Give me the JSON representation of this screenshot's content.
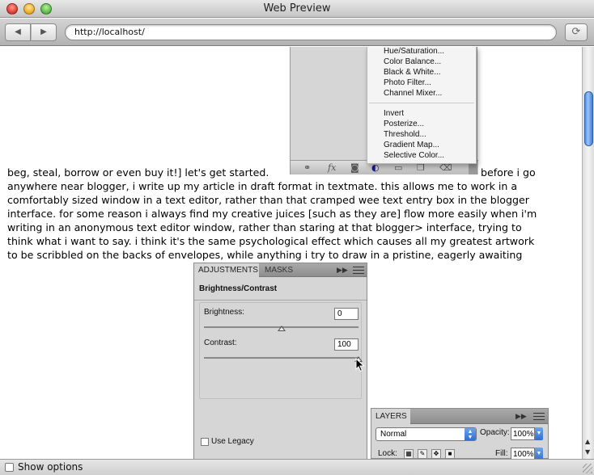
{
  "window": {
    "title": "Web Preview"
  },
  "toolbar": {
    "back_icon": "◀",
    "forward_icon": "▶",
    "url": "http://localhost/",
    "reload_icon": "⟳"
  },
  "adjustments_menu": {
    "items": [
      "Hue/Saturation...",
      "Color Balance...",
      "Black & White...",
      "Photo Filter...",
      "Channel Mixer...",
      "Invert",
      "Posterize...",
      "Threshold...",
      "Gradient Map...",
      "Selective Color..."
    ]
  },
  "article": {
    "lines": [
      "beg, steal, borrow or even buy it!] let's get started.",
      "before i go",
      "anywhere near blogger, i write up my article in draft format in textmate. this allows me to work in a",
      "comfortably sized window in a text editor, rather than that cramped wee text entry box in the blogger",
      "interface. for some reason i always find my creative juices [such as they are] flow more easily when i'm",
      "writing in an anonymous text editor window, rather than staring at that blogger> interface, trying to",
      "think what i want to say. i think it's the same psychological effect which causes all my greatest artwork",
      "to be scribbled on the backs of envelopes, while anything i try to draw in a pristine, eagerly awaiting"
    ]
  },
  "adjustments_panel": {
    "tab_active": "ADJUSTMENTS",
    "tab_inactive": "MASKS",
    "title": "Brightness/Contrast",
    "brightness_label": "Brightness:",
    "brightness_value": "0",
    "contrast_label": "Contrast:",
    "contrast_value": "100",
    "legacy_label": "Use Legacy"
  },
  "layers_panel": {
    "tab": "LAYERS",
    "blend_mode": "Normal",
    "opacity_label": "Opacity:",
    "opacity_value": "100%",
    "lock_label": "Lock:",
    "fill_label": "Fill:",
    "fill_value": "100%"
  },
  "bottom": {
    "show_options_label": "Show options"
  },
  "colors": {
    "scroll_thumb": "#4d8ee8",
    "close": "#e0443a",
    "minimize": "#f0b22e",
    "zoom": "#5fc04a"
  }
}
